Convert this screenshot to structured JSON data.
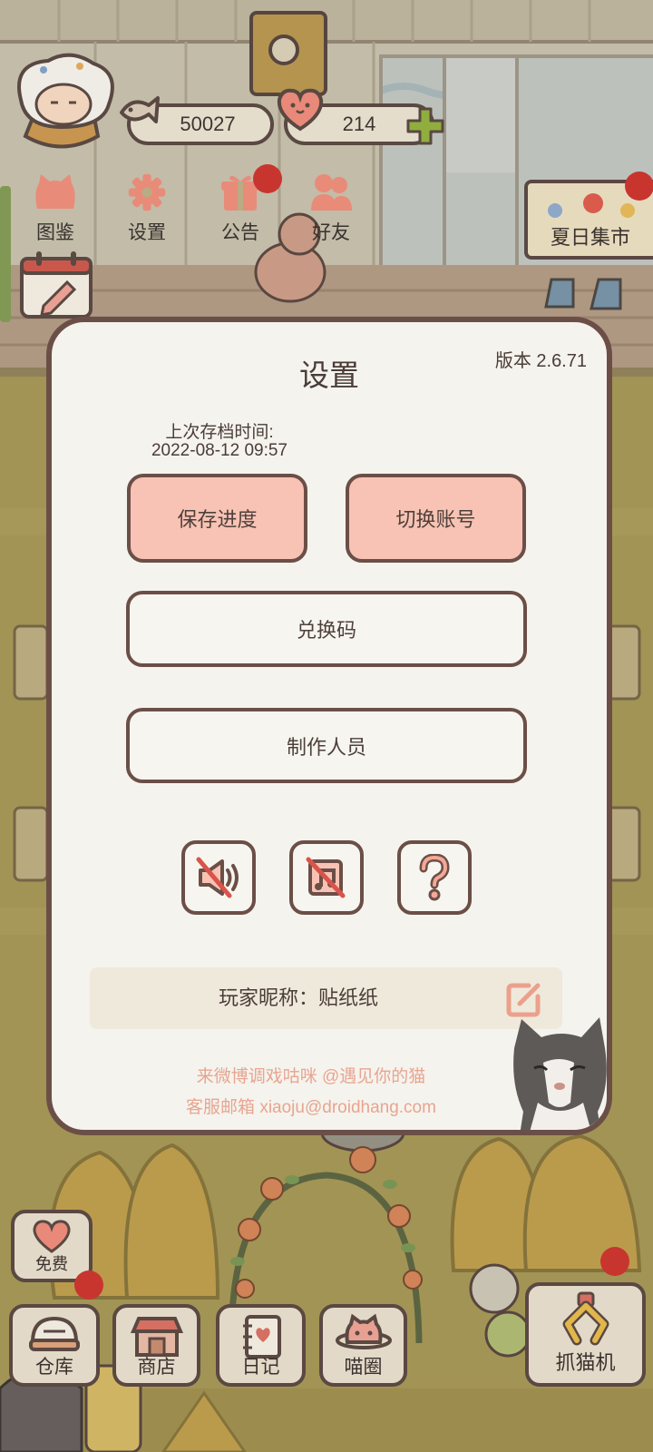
{
  "hud": {
    "fish_count": "50027",
    "heart_count": "214",
    "fish_icon": "fish-icon",
    "heart_icon": "heart-face-icon",
    "add_icon": "plus-icon"
  },
  "menu": [
    {
      "label": "图鉴",
      "icon": "cat-head-icon"
    },
    {
      "label": "设置",
      "icon": "gear-icon"
    },
    {
      "label": "公告",
      "icon": "gift-icon",
      "has_badge": true
    },
    {
      "label": "好友",
      "icon": "friends-icon"
    }
  ],
  "event_sign": {
    "label": "夏日集市",
    "has_badge": true
  },
  "calendar": {
    "icon": "calendar-icon"
  },
  "settings": {
    "title": "设置",
    "version": "版本 2.6.71",
    "last_save_label": "上次存档时间:",
    "last_save_time": "2022-08-12 09:57",
    "save_button": "保存进度",
    "switch_account_button": "切换账号",
    "redeem_code_button": "兑换码",
    "credits_button": "制作人员",
    "toggles": [
      {
        "icon": "sound-muted-icon"
      },
      {
        "icon": "music-muted-icon"
      },
      {
        "icon": "help-icon"
      }
    ],
    "nickname": "玩家昵称：贴纸纸",
    "edit_icon": "edit-icon",
    "weibo_text": "来微博调戏咕咪 @遇见你的猫",
    "email_text": "客服邮箱 xiaoju@droidhang.com"
  },
  "bottom_bar": {
    "free": {
      "label": "免费",
      "icon": "heart-icon"
    },
    "items": [
      {
        "label": "仓库",
        "icon": "storage-icon",
        "has_badge": true
      },
      {
        "label": "商店",
        "icon": "shop-icon"
      },
      {
        "label": "日记",
        "icon": "diary-icon"
      },
      {
        "label": "喵圈",
        "icon": "cat-planet-icon"
      }
    ],
    "claw_machine": {
      "label": "抓猫机",
      "icon": "claw-icon",
      "has_badge": true
    }
  },
  "colors": {
    "modal_bg": "#f5f3ee",
    "modal_border": "#6b4f47",
    "peach_button": "#f8c3b4",
    "link_pink": "#e8a590",
    "badge_red": "#c8352f",
    "plus_green": "#8fae3e",
    "icon_salmon": "#e98b79"
  }
}
